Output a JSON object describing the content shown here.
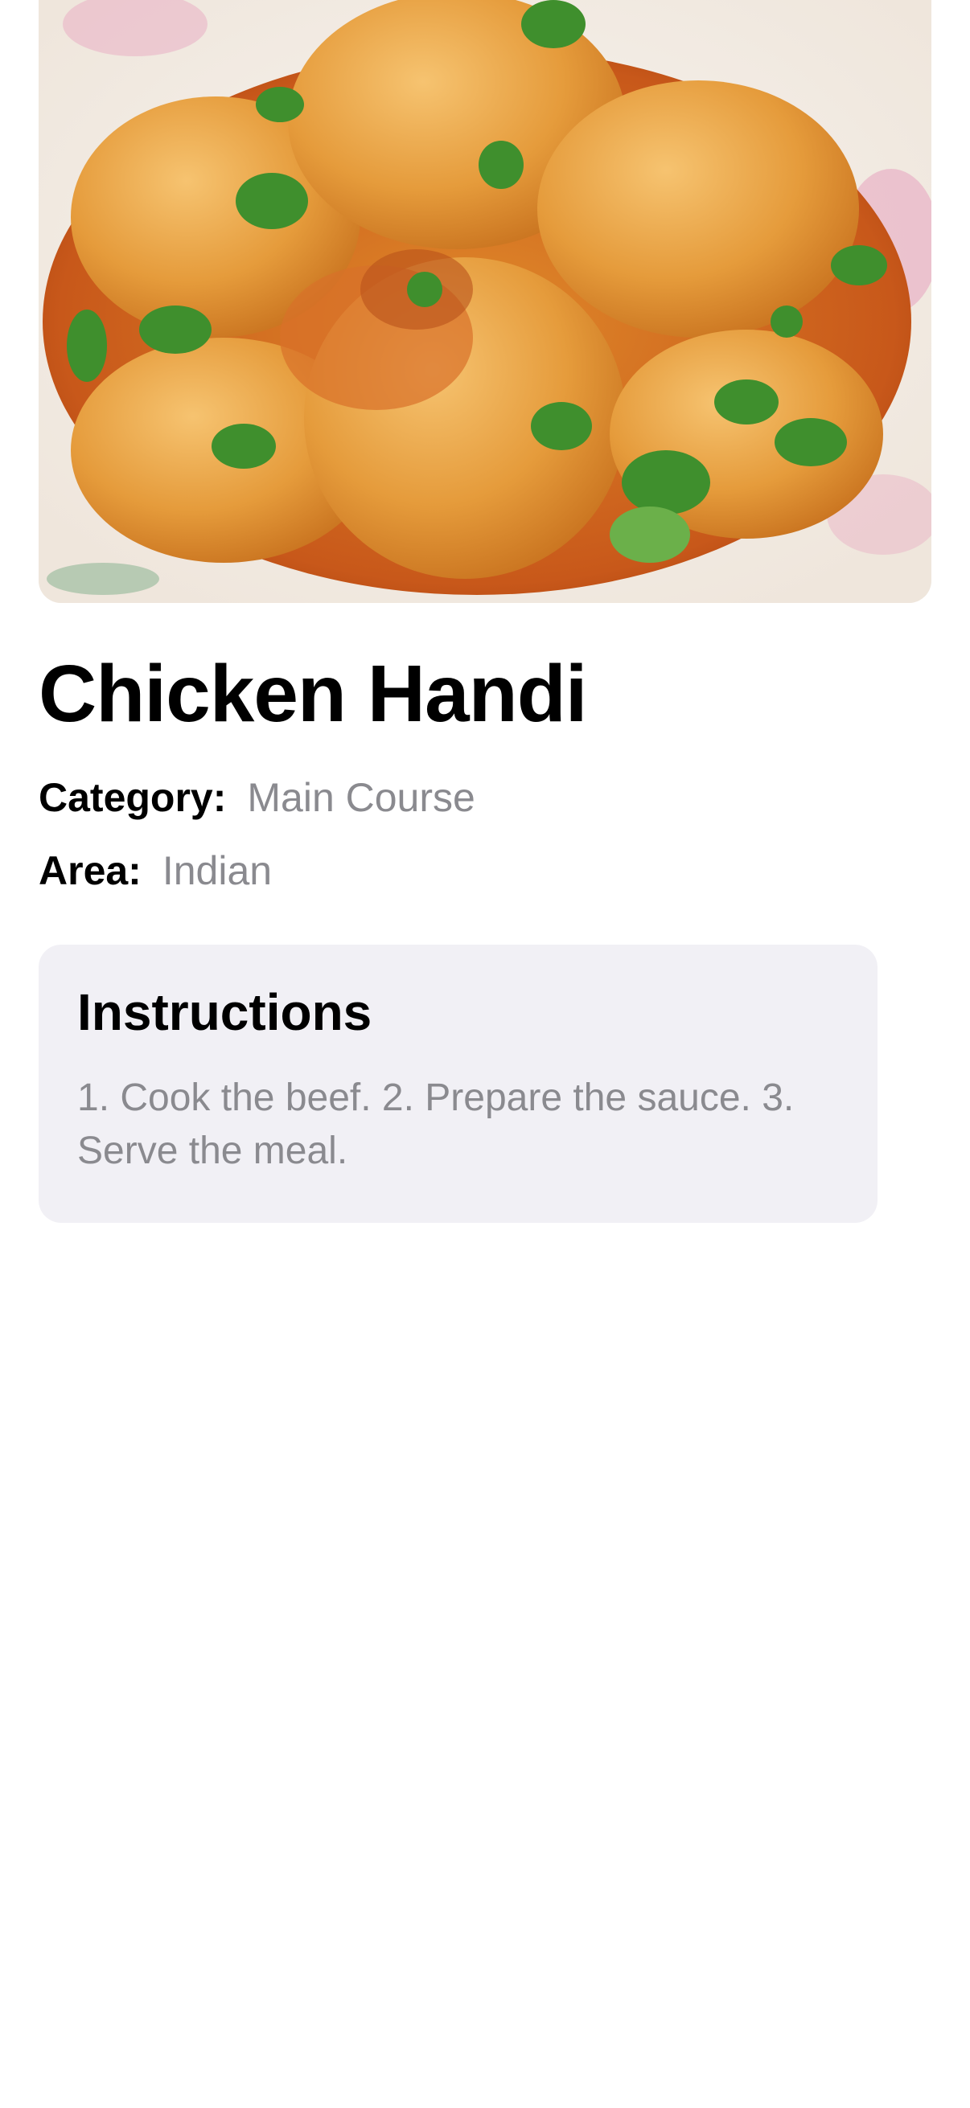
{
  "recipe": {
    "title": "Chicken Handi",
    "category_label": "Category:",
    "category_value": "Main Course",
    "area_label": "Area:",
    "area_value": "Indian"
  },
  "instructions": {
    "heading": "Instructions",
    "text": "1. Cook the beef. 2. Prepare the sauce. 3. Serve the meal."
  },
  "colors": {
    "title": "#000000",
    "secondary_text": "#8a8a8f",
    "card_background": "#f1f0f5",
    "background": "#ffffff"
  }
}
